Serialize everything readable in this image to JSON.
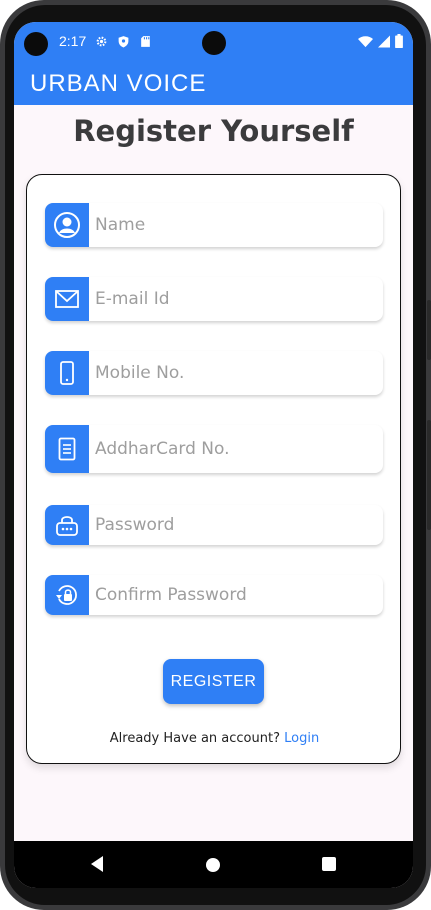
{
  "status_bar": {
    "time": "2:17",
    "icons": [
      "gear-icon",
      "shield-icon",
      "sdcard-icon",
      "wifi-icon",
      "signal-icon",
      "battery-icon"
    ]
  },
  "app_bar": {
    "title": "URBAN VOICE"
  },
  "page": {
    "title": "Register Yourself"
  },
  "form": {
    "fields": [
      {
        "placeholder": "Name",
        "icon": "user-circle-icon"
      },
      {
        "placeholder": "E-mail Id",
        "icon": "envelope-icon"
      },
      {
        "placeholder": "Mobile No.",
        "icon": "mobile-phone-icon"
      },
      {
        "placeholder": "AddharCard No.",
        "icon": "document-icon"
      },
      {
        "placeholder": "Password",
        "icon": "lock-icon"
      },
      {
        "placeholder": "Confirm Password",
        "icon": "lock-reset-icon"
      }
    ],
    "register_label": "REGISTER",
    "login_prompt": "Already Have an account?",
    "login_link": "Login"
  },
  "colors": {
    "primary": "#2f7ff5",
    "background": "#fdf7fb",
    "title_text": "#3b3b3d",
    "placeholder": "#9e9e9e"
  }
}
